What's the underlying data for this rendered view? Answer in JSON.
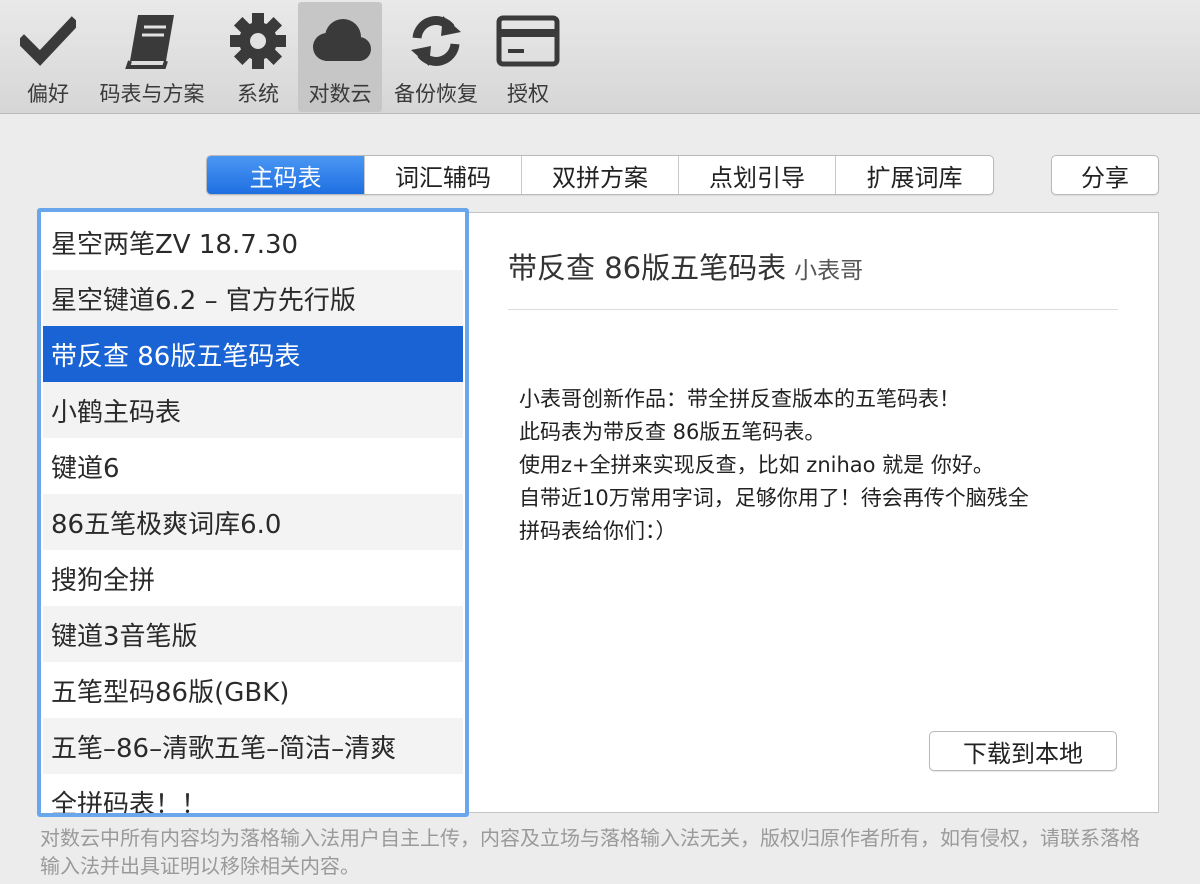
{
  "toolbar": {
    "items": [
      {
        "label": "偏好",
        "icon": "checkmark-icon"
      },
      {
        "label": "码表与方案",
        "icon": "book-icon"
      },
      {
        "label": "系统",
        "icon": "gear-icon"
      },
      {
        "label": "对数云",
        "icon": "cloud-icon",
        "active": true
      },
      {
        "label": "备份恢复",
        "icon": "sync-icon"
      },
      {
        "label": "授权",
        "icon": "card-icon"
      }
    ]
  },
  "tabs": [
    {
      "label": "主码表",
      "active": true
    },
    {
      "label": "词汇辅码"
    },
    {
      "label": "双拼方案"
    },
    {
      "label": "点划引导"
    },
    {
      "label": "扩展词库"
    }
  ],
  "share_label": "分享",
  "list": {
    "items": [
      "星空两笔ZV 18.7.30",
      "星空键道6.2 – 官方先行版",
      "带反查 86版五笔码表",
      "小鹤主码表",
      "键道6",
      "86五笔极爽词库6.0",
      "搜狗全拼",
      "键道3音笔版",
      "五笔型码86版(GBK)",
      "五笔–86–清歌五笔–简洁–清爽",
      "全拼码表！！"
    ],
    "selected_index": 2
  },
  "detail": {
    "title": "带反查 86版五笔码表",
    "author": "小表哥",
    "description": [
      "小表哥创新作品：带全拼反查版本的五笔码表！",
      "此码表为带反查 86版五笔码表。",
      "使用z+全拼来实现反查，比如 znihao 就是 你好。",
      "自带近10万常用字词，足够你用了！待会再传个脑残全",
      "拼码表给你们：）"
    ],
    "download_label": "下载到本地"
  },
  "disclaimer": "对数云中所有内容均为落格输入法用户自主上传，内容及立场与落格输入法无关，版权归原作者所有，如有侵权，请联系落格输入法并出具证明以移除相关内容。",
  "colors": {
    "accent": "#1a63d4",
    "list_focus_ring": "#6aa6ec",
    "toolbar_icon": "#3a3a3a"
  }
}
